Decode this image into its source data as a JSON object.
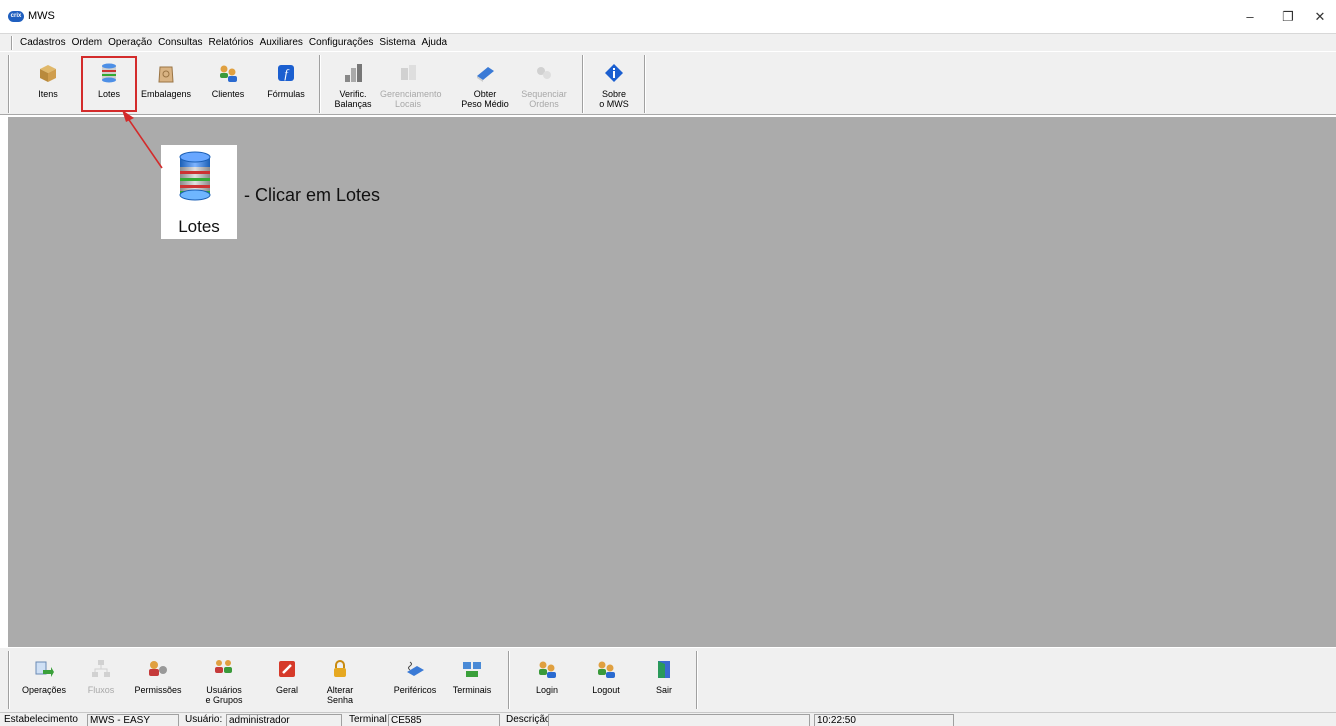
{
  "window": {
    "title": "MWS",
    "logo_text": "crix",
    "minimize_glyph": "–",
    "restore_glyph": "❐",
    "close_glyph": "✕"
  },
  "menu": [
    "Cadastros",
    "Ordem",
    "Operação",
    "Consultas",
    "Relatórios",
    "Auxiliares",
    "Configurações",
    "Sistema",
    "Ajuda"
  ],
  "top_toolbar": [
    {
      "label": "Itens",
      "icon": "box-icon",
      "enabled": true
    },
    {
      "label": "Lotes",
      "icon": "database-icon",
      "enabled": true,
      "selected": true
    },
    {
      "label": "Embalagens",
      "icon": "package-bag-icon",
      "enabled": true
    },
    {
      "label": "Clientes",
      "icon": "users-icon",
      "enabled": true
    },
    {
      "label": "Fórmulas",
      "icon": "formula-icon",
      "enabled": true
    },
    {
      "label": "Verific.\nBalanças",
      "icon": "scale-icon",
      "enabled": true
    },
    {
      "label": "Gerenciamento\nLocais",
      "icon": "locations-icon",
      "enabled": false
    },
    {
      "label": "Obter\nPeso Médio",
      "icon": "weight-icon",
      "enabled": true
    },
    {
      "label": "Sequenciar\nOrdens",
      "icon": "sequence-icon",
      "enabled": false
    },
    {
      "label": "Sobre\no MWS",
      "icon": "info-icon",
      "enabled": true
    }
  ],
  "callout": {
    "label": "Lotes",
    "text": "-  Clicar em Lotes"
  },
  "bottom_toolbar": [
    {
      "label": "Operações",
      "icon": "operations-icon",
      "enabled": true
    },
    {
      "label": "Fluxos",
      "icon": "flow-icon",
      "enabled": false
    },
    {
      "label": "Permissões",
      "icon": "permissions-icon",
      "enabled": true
    },
    {
      "label": "Usuários\ne Grupos",
      "icon": "user-groups-icon",
      "enabled": true
    },
    {
      "label": "Geral",
      "icon": "general-settings-icon",
      "enabled": true
    },
    {
      "label": "Alterar\nSenha",
      "icon": "lock-icon",
      "enabled": true
    },
    {
      "label": "Periféricos",
      "icon": "peripherals-icon",
      "enabled": true
    },
    {
      "label": "Terminais",
      "icon": "terminals-icon",
      "enabled": true
    },
    {
      "label": "Login",
      "icon": "login-icon",
      "enabled": true
    },
    {
      "label": "Logout",
      "icon": "logout-icon",
      "enabled": true
    },
    {
      "label": "Sair",
      "icon": "exit-door-icon",
      "enabled": true
    }
  ],
  "status": {
    "estabelecimento_label": "Estabelecimento",
    "estabelecimento_value": "MWS - EASY",
    "usuario_label": "Usuário:",
    "usuario_value": "administrador",
    "terminal_label": "Terminal",
    "terminal_value": "CE585",
    "descricao_label": "Descrição",
    "descricao_value": "",
    "time": "10:22:50"
  },
  "colors": {
    "workspace": "#ababab",
    "toolbar": "#f0f0f0",
    "highlight": "#d32b2b"
  }
}
